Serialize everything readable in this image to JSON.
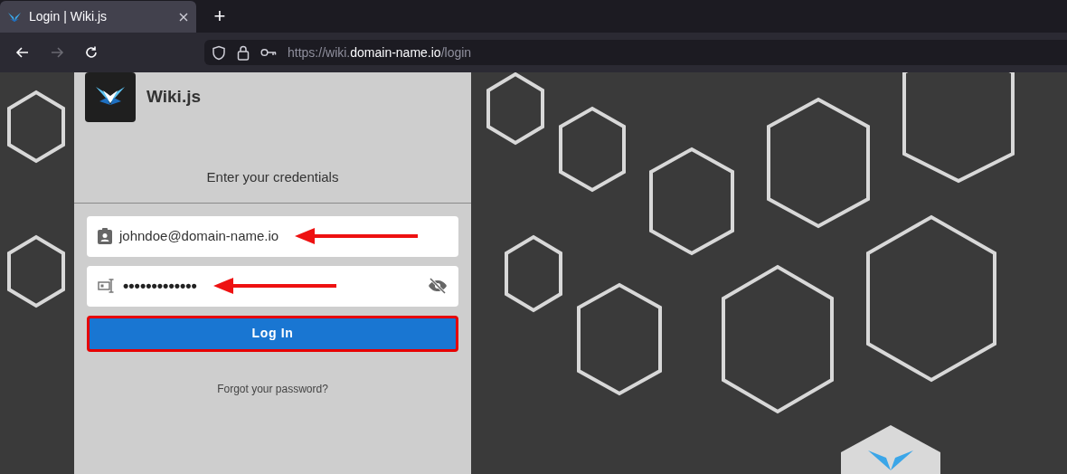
{
  "browser": {
    "tab": {
      "title": "Login | Wiki.js",
      "selected": true
    },
    "new_tab": "+",
    "nav": [
      {
        "kind": "back",
        "disabled": false
      },
      {
        "kind": "forward",
        "disabled": true
      },
      {
        "kind": "reload",
        "disabled": false
      }
    ],
    "url": "https://wiki.**domain-name.io**/login"
  },
  "page": {
    "brand": "Wiki.js",
    "heading": "Enter your credentials",
    "fields": [
      {
        "kind": "email",
        "value": "johndoe@domain-name.io",
        "annotated": true
      },
      {
        "kind": "password",
        "value": "•••••••••••••",
        "annotated": true
      }
    ],
    "login_button": {
      "label": "Log In",
      "highlighted": true
    },
    "forgot_link": "Forgot your password?"
  }
}
